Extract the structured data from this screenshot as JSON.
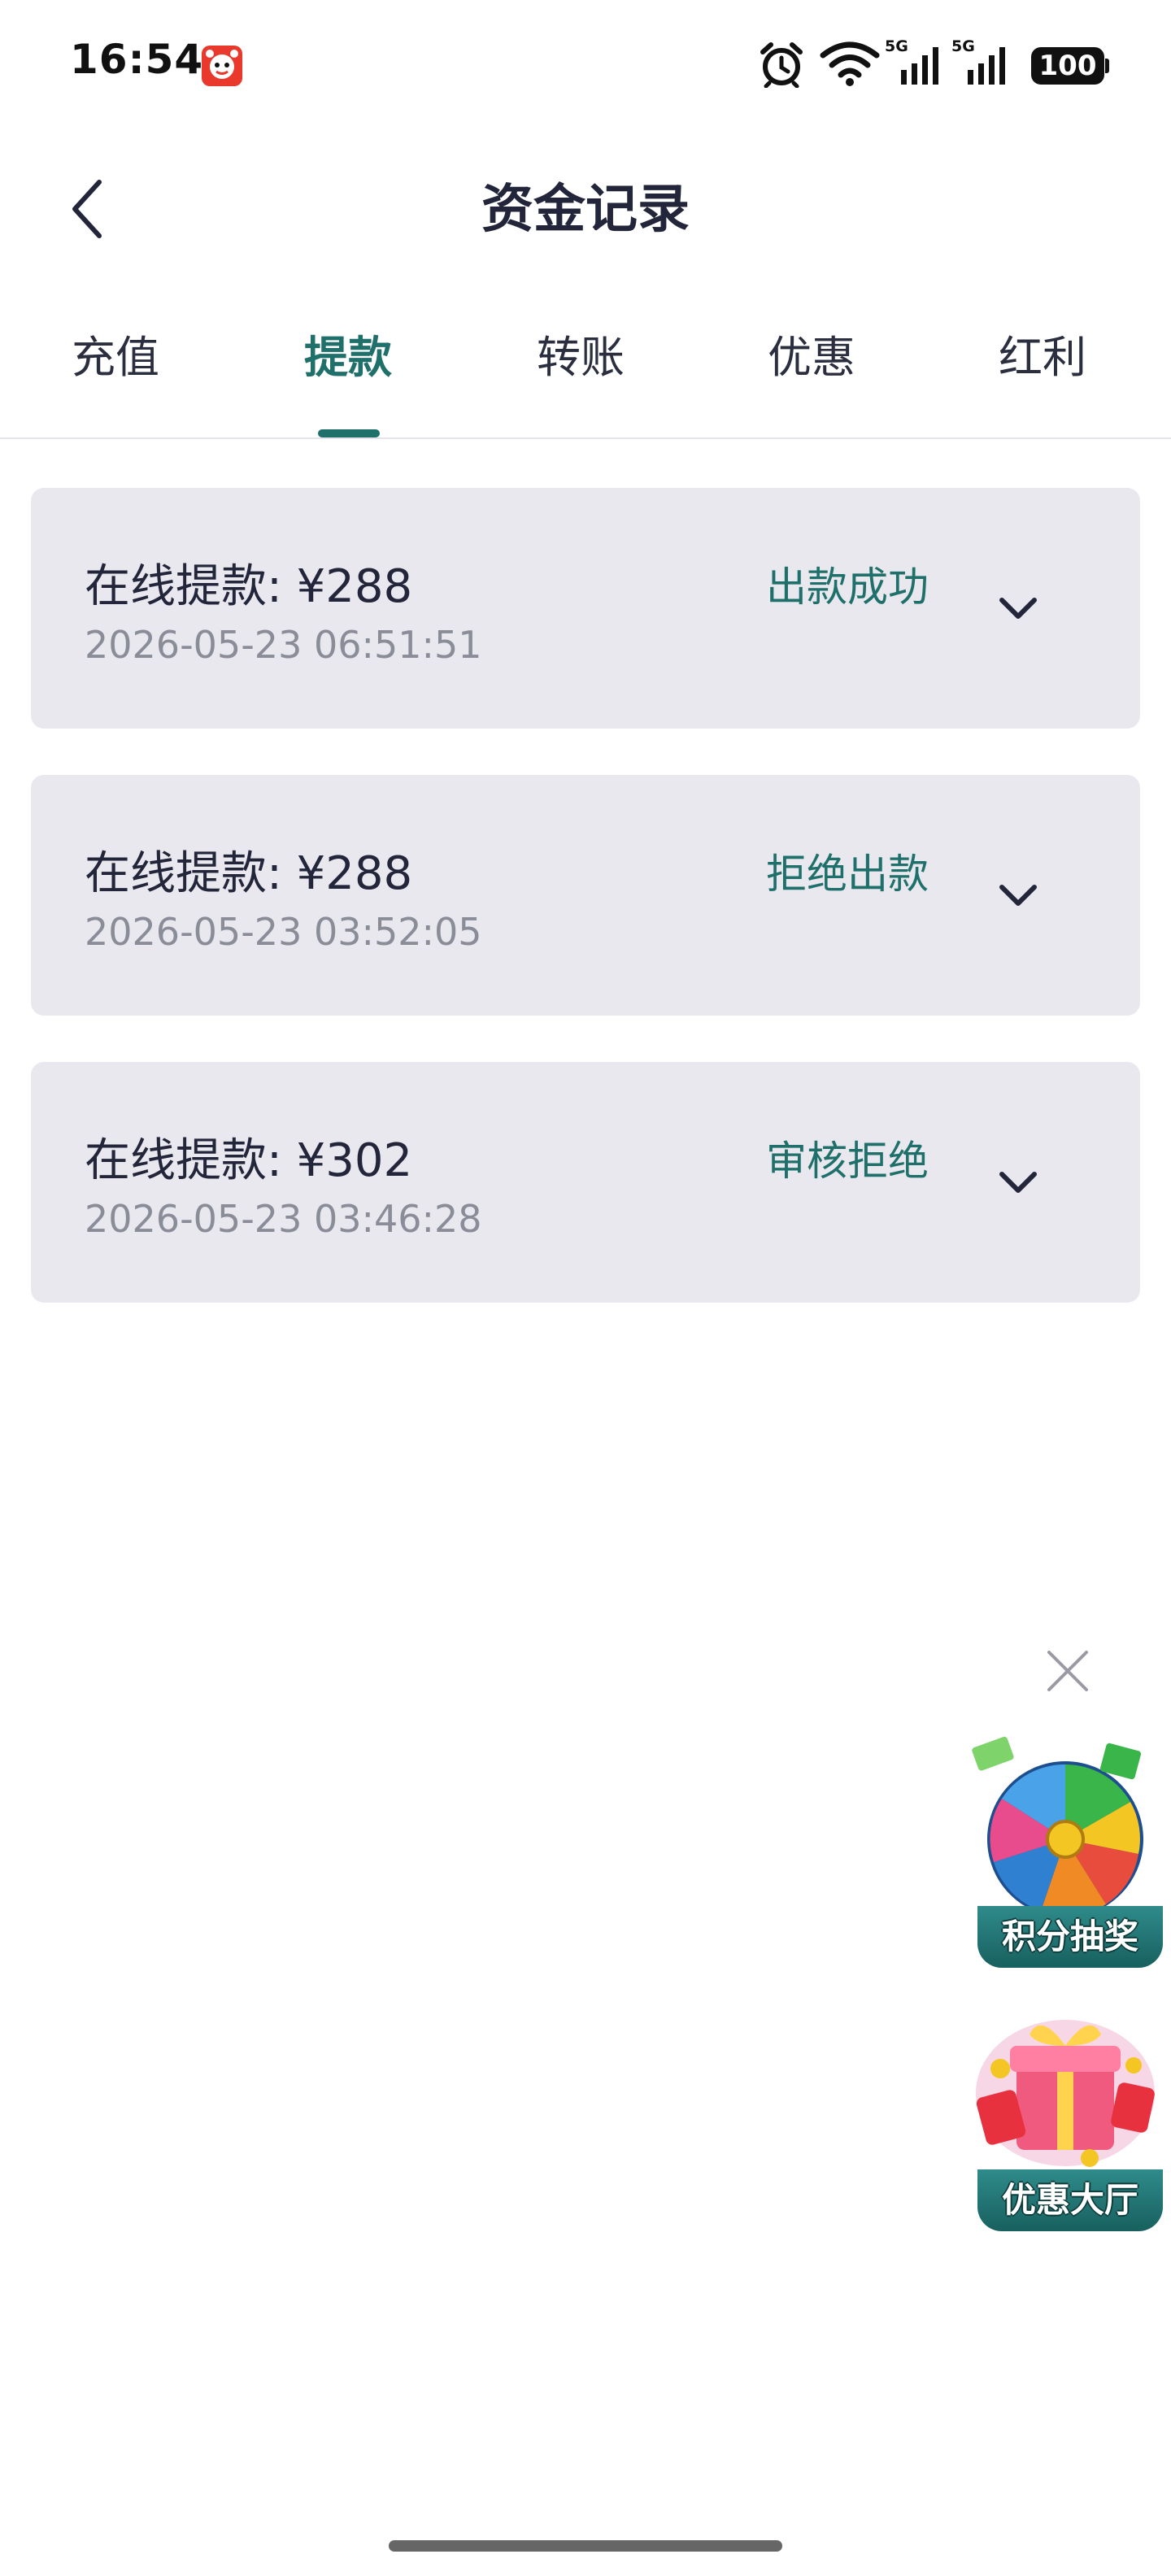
{
  "status_bar": {
    "time": "16:54",
    "network_tag_1": "5G",
    "network_tag_2": "5G",
    "battery": "100"
  },
  "header": {
    "title": "资金记录"
  },
  "tabs": [
    {
      "label": "充值",
      "active": false
    },
    {
      "label": "提款",
      "active": true
    },
    {
      "label": "转账",
      "active": false
    },
    {
      "label": "优惠",
      "active": false
    },
    {
      "label": "红利",
      "active": false
    }
  ],
  "records": [
    {
      "label": "在线提款: ¥288",
      "time": "2026-05-23 06:51:51",
      "status": "出款成功"
    },
    {
      "label": "在线提款: ¥288",
      "time": "2026-05-23 03:52:05",
      "status": "拒绝出款"
    },
    {
      "label": "在线提款: ¥302",
      "time": "2026-05-23 03:46:28",
      "status": "审核拒绝"
    }
  ],
  "promos": [
    {
      "label": "积分抽奖",
      "icon": "prize-wheel-icon"
    },
    {
      "label": "优惠大厅",
      "icon": "gift-box-icon"
    }
  ],
  "colors": {
    "accent": "#1f6f6a",
    "card_bg": "#e8e8ee",
    "text_primary": "#23263a",
    "text_secondary": "#8a8c98"
  }
}
